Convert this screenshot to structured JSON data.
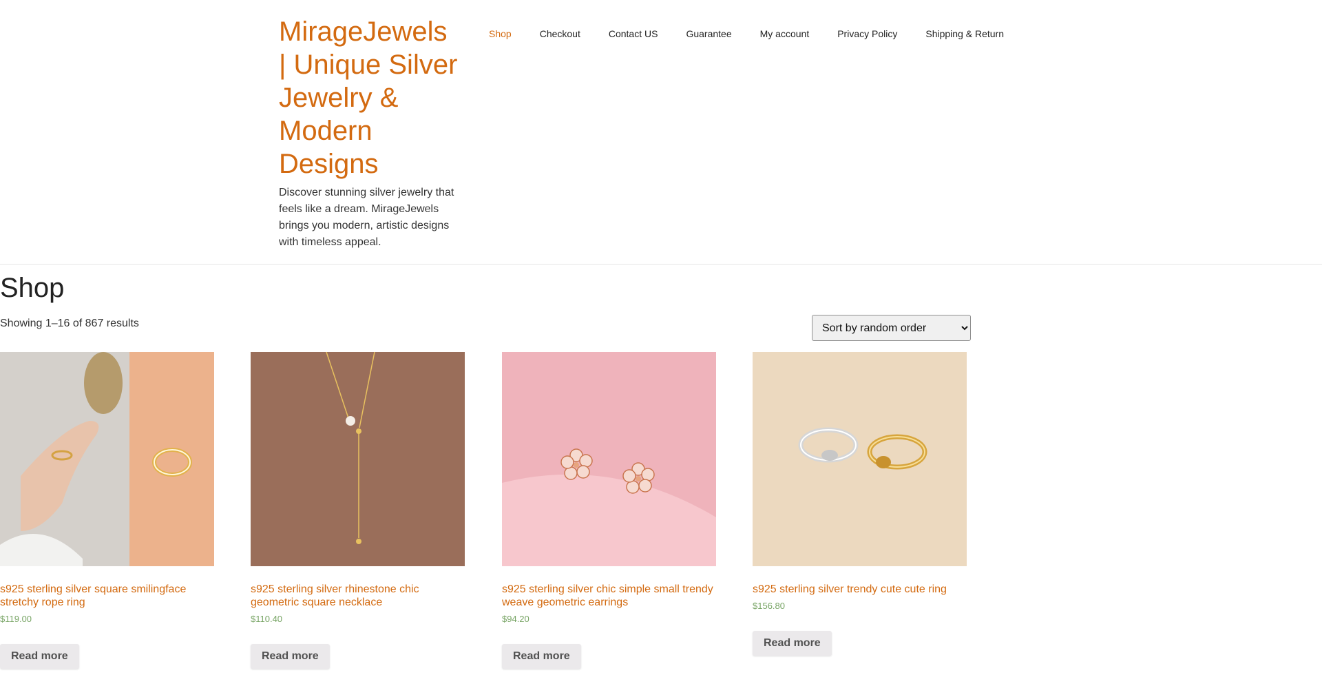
{
  "site": {
    "title": "MirageJewels | Unique Silver Jewelry & Modern Designs",
    "description": "Discover stunning silver jewelry that feels like a dream. MirageJewels brings you modern, artistic designs with timeless appeal."
  },
  "nav": {
    "items": [
      {
        "label": "Shop",
        "active": true
      },
      {
        "label": "Checkout"
      },
      {
        "label": "Contact US"
      },
      {
        "label": "Guarantee"
      },
      {
        "label": "My account"
      },
      {
        "label": "Privacy Policy"
      },
      {
        "label": "Shipping & Return"
      }
    ]
  },
  "shop": {
    "title": "Shop",
    "result_count": "Showing 1–16 of 867 results",
    "sort": {
      "selected": "Sort by random order"
    }
  },
  "products": [
    {
      "title": "s925 sterling silver square smilingface stretchy rope ring",
      "price": "$119.00",
      "button": "Read more"
    },
    {
      "title": "s925 sterling silver rhinestone chic geometric square necklace",
      "price": "$110.40",
      "button": "Read more"
    },
    {
      "title": "s925 sterling silver chic simple small trendy weave geometric earrings",
      "price": "$94.20",
      "button": "Read more"
    },
    {
      "title": "s925 sterling silver trendy cute cute ring",
      "price": "$156.80",
      "button": "Read more"
    }
  ],
  "colors": {
    "accent": "#d36a10",
    "price": "#77a464",
    "button_bg": "#ebe9eb"
  }
}
